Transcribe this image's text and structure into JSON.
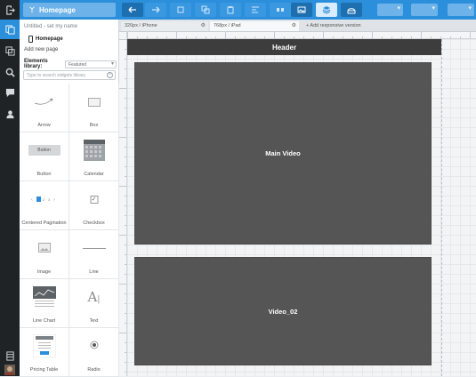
{
  "toolbar": {
    "page_name": "Homepage"
  },
  "panel": {
    "project_title": "Untitled - set my name",
    "current_page": "Homepage",
    "add_page_label": "Add new page",
    "library_label": "Elements library:",
    "library_selected": "Featured",
    "search_placeholder": "Type to search widgets library"
  },
  "widgets": [
    {
      "label": "Arrow"
    },
    {
      "label": "Box"
    },
    {
      "label": "Button",
      "preview_text": "Button"
    },
    {
      "label": "Calendar"
    },
    {
      "label": "Centered Pagination"
    },
    {
      "label": "Checkbox"
    },
    {
      "label": "Image"
    },
    {
      "label": "Line"
    },
    {
      "label": "Line Chart"
    },
    {
      "label": "Text"
    },
    {
      "label": "Pricing Table"
    },
    {
      "label": "Radio"
    }
  ],
  "tabs": [
    {
      "label": "320px / iPhone"
    },
    {
      "label": "768px / iPad"
    },
    {
      "label": "+ Add responsive version"
    }
  ],
  "canvas": {
    "header_label": "Header",
    "video1_label": "Main Video",
    "video2_label": "Video_02"
  },
  "colors": {
    "accent": "#2b8fdc",
    "rail": "#1f2326",
    "placeholder_block": "#555555",
    "header_block": "#3d3d3d"
  }
}
